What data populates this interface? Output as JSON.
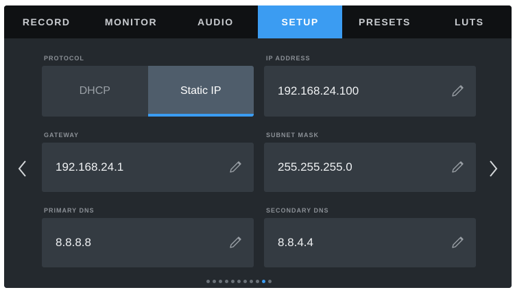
{
  "tabs": [
    {
      "label": "RECORD",
      "active": false
    },
    {
      "label": "MONITOR",
      "active": false
    },
    {
      "label": "AUDIO",
      "active": false
    },
    {
      "label": "SETUP",
      "active": true
    },
    {
      "label": "PRESETS",
      "active": false
    },
    {
      "label": "LUTS",
      "active": false
    }
  ],
  "protocol": {
    "label": "PROTOCOL",
    "options": [
      "DHCP",
      "Static IP"
    ],
    "selected": "Static IP"
  },
  "ip_address": {
    "label": "IP ADDRESS",
    "value": "192.168.24.100"
  },
  "gateway": {
    "label": "GATEWAY",
    "value": "192.168.24.1"
  },
  "subnet_mask": {
    "label": "SUBNET MASK",
    "value": "255.255.255.0"
  },
  "primary_dns": {
    "label": "PRIMARY DNS",
    "value": "8.8.8.8"
  },
  "secondary_dns": {
    "label": "SECONDARY DNS",
    "value": "8.8.4.4"
  },
  "pagination": {
    "total": 11,
    "current": 10
  },
  "icons": {
    "edit": "pencil-icon",
    "prev": "chevron-left-icon",
    "next": "chevron-right-icon"
  },
  "colors": {
    "accent": "#3b9cf2",
    "background": "#24292e",
    "field": "#343b42"
  }
}
